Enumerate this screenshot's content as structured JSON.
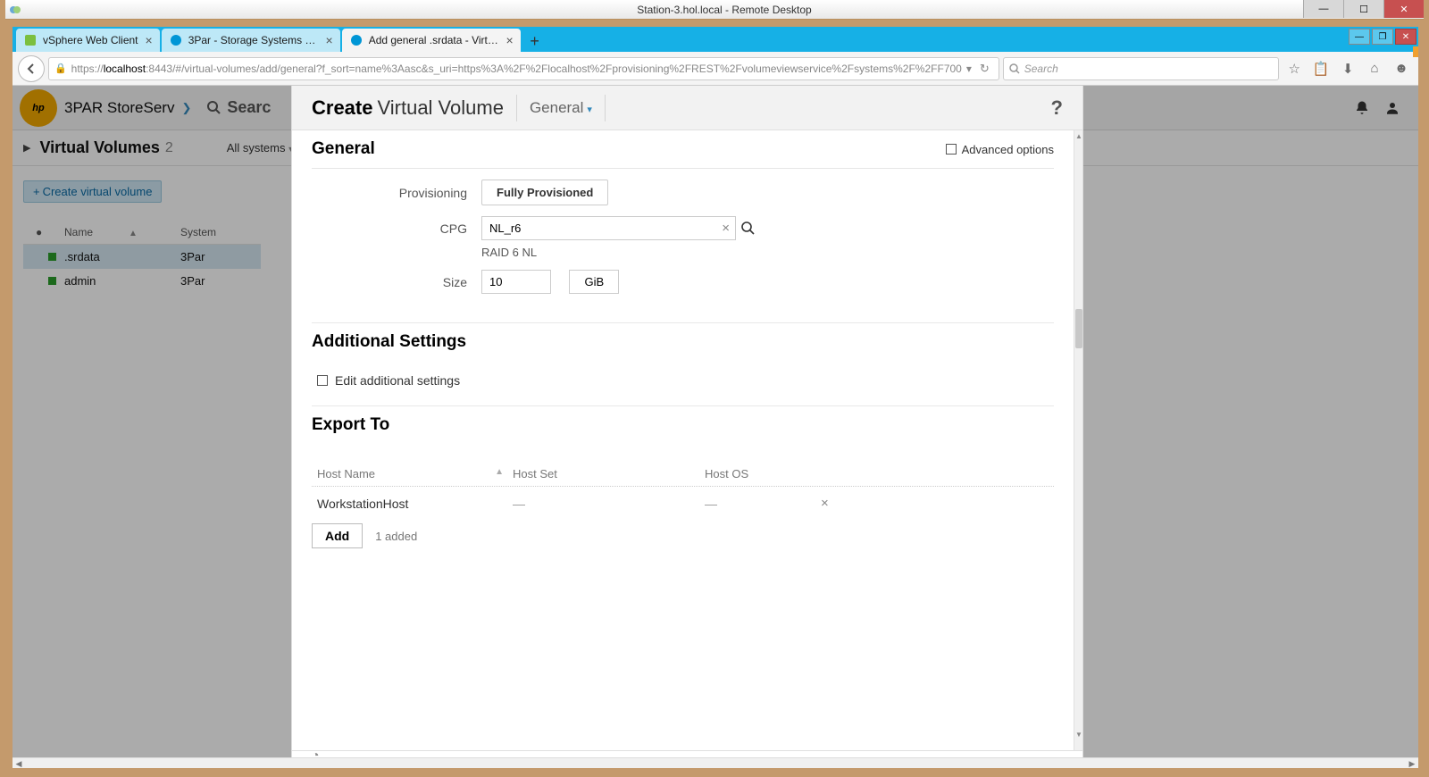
{
  "window": {
    "title": "Station-3.hol.local - Remote Desktop"
  },
  "browser": {
    "tabs": [
      {
        "label": "vSphere Web Client",
        "active": false,
        "icon_color": "#7bbf3f"
      },
      {
        "label": "3Par - Storage Systems - H...",
        "active": false,
        "icon_color": "#0096d6"
      },
      {
        "label": "Add general .srdata - Virtu...",
        "active": true,
        "icon_color": "#0096d6"
      }
    ],
    "url": "https://localhost:8443/#/virtual-volumes/add/general?f_sort=name%3Aasc&s_uri=https%3A%2F%2Flocalhost%2Fprovisioning%2FREST%2Fvolumeviewservice%2Fsystems%2F%2FF700",
    "url_host": "localhost",
    "search_placeholder": "Search"
  },
  "app": {
    "brand": "3PAR StoreServ",
    "search_label": "Searc",
    "page_title": "Virtual Volumes",
    "page_count": "2",
    "filter_label": "All systems",
    "create_btn": "Create virtual volume",
    "columns": {
      "name": "Name",
      "system": "System"
    },
    "rows": [
      {
        "name": ".srdata",
        "system": "3Par",
        "selected": true
      },
      {
        "name": "admin",
        "system": "3Par",
        "selected": false
      }
    ]
  },
  "modal": {
    "title_pre": "Create",
    "title_post": "Virtual Volume",
    "section_dd": "General",
    "help": "?",
    "general": {
      "heading": "General",
      "advanced": "Advanced options",
      "provisioning_label": "Provisioning",
      "provisioning_value": "Fully Provisioned",
      "cpg_label": "CPG",
      "cpg_value": "NL_r6",
      "cpg_sub": "RAID 6 NL",
      "size_label": "Size",
      "size_value": "10",
      "size_unit": "GiB"
    },
    "additional": {
      "heading": "Additional Settings",
      "edit_label": "Edit additional settings"
    },
    "export": {
      "heading": "Export To",
      "col_hostname": "Host Name",
      "col_hostset": "Host Set",
      "col_hostos": "Host OS",
      "row_hostname": "WorkstationHost",
      "row_hostset": "—",
      "row_hostos": "—",
      "add_btn": "Add",
      "added_text": "1 added"
    }
  }
}
